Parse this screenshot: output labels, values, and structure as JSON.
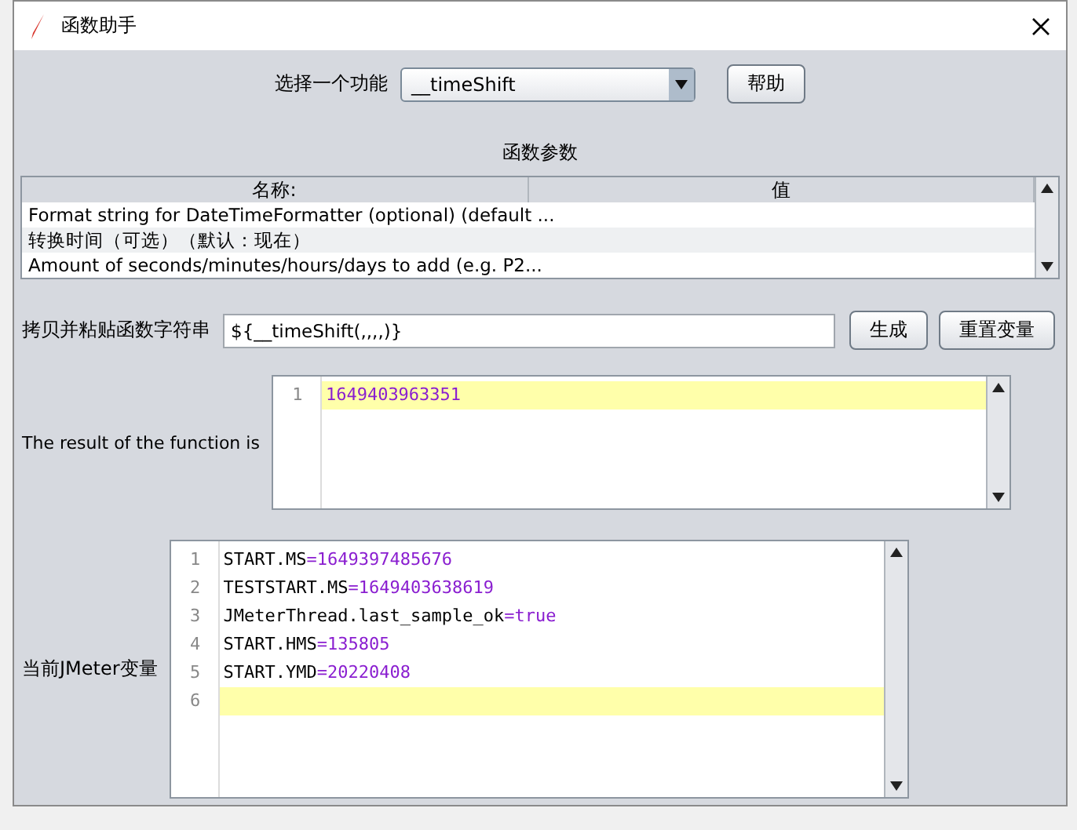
{
  "window": {
    "title": "函数助手"
  },
  "function_select": {
    "label": "选择一个功能",
    "value": "__timeShift",
    "help_button": "帮助"
  },
  "params": {
    "title": "函数参数",
    "columns": [
      "名称:",
      "值"
    ],
    "rows": [
      {
        "name": "Format string for DateTimeFormatter (optional) (default ..."
      },
      {
        "name": "转换时间（可选）（默认：现在）"
      },
      {
        "name": "Amount of seconds/minutes/hours/days to add (e.g. P2..."
      }
    ]
  },
  "copy": {
    "label": "拷贝并粘贴函数字符串",
    "value": "${__timeShift(,,,,)}",
    "buttons": [
      "生成",
      "重置变量"
    ]
  },
  "result": {
    "label": "The result of the function is",
    "lines": [
      {
        "number": "1",
        "value": "1649403963351",
        "current": true
      }
    ]
  },
  "variables": {
    "label": "当前JMeter变量",
    "lines": [
      {
        "number": "1",
        "key": "START.MS",
        "sep": "=",
        "value": "1649397485676",
        "current": false
      },
      {
        "number": "2",
        "key": "TESTSTART.MS",
        "sep": "=",
        "value": "1649403638619",
        "current": false
      },
      {
        "number": "3",
        "key": "JMeterThread.last_sample_ok",
        "sep": "=",
        "value": "true",
        "current": false
      },
      {
        "number": "4",
        "key": "START.HMS",
        "sep": "=",
        "value": "135805",
        "current": false
      },
      {
        "number": "5",
        "key": "START.YMD",
        "sep": "=",
        "value": "20220408",
        "current": false
      },
      {
        "number": "6",
        "current": true
      }
    ]
  }
}
